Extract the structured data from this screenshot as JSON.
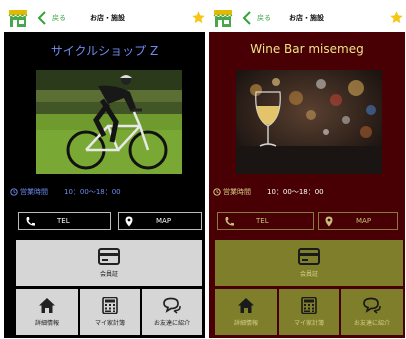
{
  "screens": [
    {
      "theme": {
        "bg": "#000000",
        "accent": "#6e8cf0",
        "hours_label_color": "#6e8cf0",
        "hours_time_color": "#6e8cf0",
        "button_text_color": "#ffffff",
        "tile_bg": "#d6d6d6",
        "tile_icon_color": "#222222",
        "tile_text_color": "#222222",
        "back_color": "#36a33a"
      },
      "header": {
        "back_label": "戻る",
        "title": "お店・施設",
        "store_icon": "store-icon",
        "star_icon": "star-icon"
      },
      "shop": {
        "name": "サイクルショップ Z",
        "photo": "cyclist-photo"
      },
      "hours": {
        "label": "営業時間",
        "time": "10：00〜18：00"
      },
      "links": {
        "tel": "TEL",
        "map": "MAP"
      },
      "member_card": {
        "label": "会員証",
        "icon": "card-icon"
      },
      "tiles": [
        {
          "label": "詳細情報",
          "icon": "home-icon"
        },
        {
          "label": "マイ家計簿",
          "icon": "calculator-icon"
        },
        {
          "label": "お友達に紹介",
          "icon": "chat-icon"
        }
      ]
    },
    {
      "theme": {
        "bg": "#480004",
        "accent": "#efe48a",
        "hours_label_color": "#d8cf85",
        "hours_time_color": "#ffffff",
        "button_text_color": "#c8c07a",
        "tile_bg": "#7f7e2a",
        "tile_icon_color": "#1a1a1a",
        "tile_text_color": "#d2cf8a",
        "back_color": "#36a33a"
      },
      "header": {
        "back_label": "戻る",
        "title": "お店・施設",
        "store_icon": "store-icon",
        "star_icon": "star-icon"
      },
      "shop": {
        "name": "Wine Bar misemeg",
        "photo": "wine-glass-photo"
      },
      "hours": {
        "label": "営業時間",
        "time": "10：00〜18：00"
      },
      "links": {
        "tel": "TEL",
        "map": "MAP"
      },
      "member_card": {
        "label": "会員証",
        "icon": "card-icon"
      },
      "tiles": [
        {
          "label": "詳細情報",
          "icon": "home-icon"
        },
        {
          "label": "マイ家計簿",
          "icon": "calculator-icon"
        },
        {
          "label": "お友達に紹介",
          "icon": "chat-icon"
        }
      ]
    }
  ]
}
